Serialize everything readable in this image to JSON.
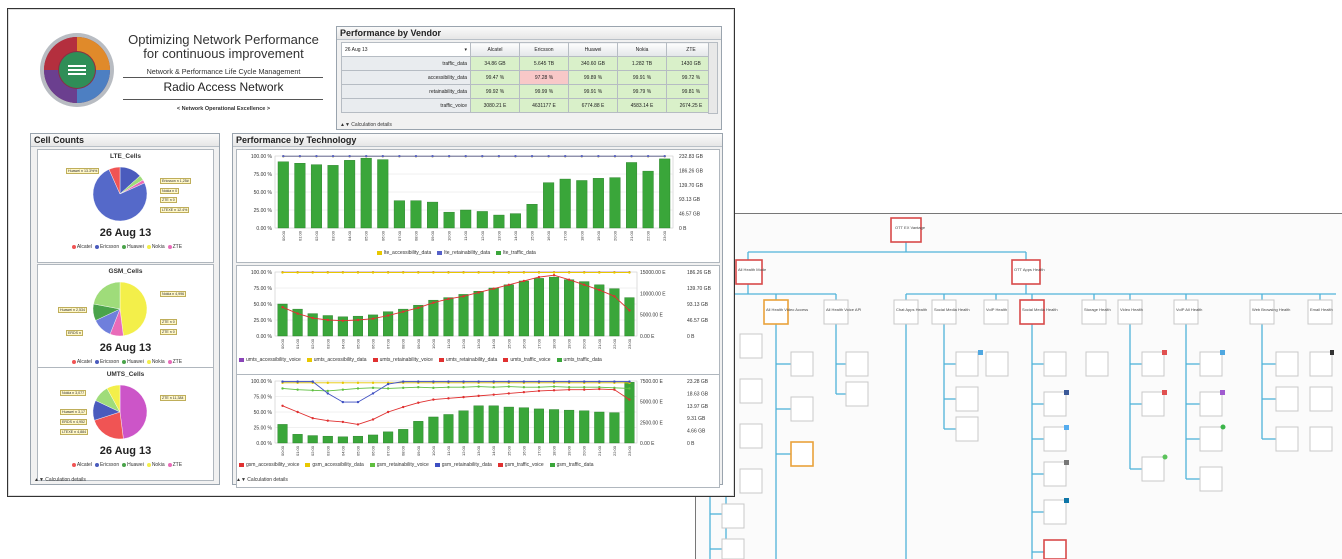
{
  "header": {
    "title_line1": "Optimizing Network Performance",
    "title_line2": "for continuous improvement",
    "subtitle": "Network & Performance Life Cycle Management",
    "subtitle2": "Radio Access Network",
    "tagline": "< Network Operational Excellence >"
  },
  "vendor_panel": {
    "title": "Performance by Vendor",
    "selected_date": "26 Aug 13",
    "columns": [
      "Alcatel",
      "Ericsson",
      "Huawei",
      "Nokia",
      "ZTE"
    ],
    "rows": [
      {
        "kpi": "traffic_data",
        "values": [
          "34.86 GB",
          "5.645 TB",
          "340.60 GB",
          "1.282 TB",
          "1430 GB"
        ]
      },
      {
        "kpi": "accessibility_data",
        "values": [
          "99.47 %",
          "97.28 %",
          "99.89 %",
          "99.91 %",
          "99.72 %"
        ]
      },
      {
        "kpi": "retainability_data",
        "values": [
          "99.92 %",
          "99.99 %",
          "99.91 %",
          "99.79 %",
          "99.81 %"
        ]
      },
      {
        "kpi": "traffic_voice",
        "values": [
          "3080.21 E",
          "4631177 E",
          "6774.88 E",
          "4583.14 E",
          "2674.25 E"
        ]
      }
    ],
    "footer": "Calculation details"
  },
  "cells_panel": {
    "title": "Cell Counts",
    "pies": [
      {
        "title": "LTE_Cells",
        "date": "26 Aug 13",
        "slices": [
          {
            "name": "Huawei",
            "value": 13.3,
            "color": "#4a5bbd"
          },
          {
            "name": "Nokia",
            "value": 3,
            "color": "#9fdc7a"
          },
          {
            "name": "ZTE",
            "value": 2,
            "color": "#e96bb9"
          },
          {
            "name": "Ericsson",
            "value": 75,
            "color": "#5569c9"
          },
          {
            "name": "Alcatel",
            "value": 6.7,
            "color": "#f05454"
          }
        ],
        "labels": [
          "Huawei n 13.3%%",
          "Ericsson n 1,25#",
          "Nokia n 0",
          "ZTE n 0",
          "LTEXE n 12.4%"
        ]
      },
      {
        "title": "GSM_Cells",
        "date": "26 Aug 13",
        "slices": [
          {
            "name": "Nokia",
            "value": 48,
            "color": "#f3ef4a"
          },
          {
            "name": "ZTE",
            "value": 8,
            "color": "#e96bb9"
          },
          {
            "name": "Huawei",
            "value": 12,
            "color": "#6f7fdc"
          },
          {
            "name": "Ericsson",
            "value": 10,
            "color": "#4aa34a"
          },
          {
            "name": "Alcatel",
            "value": 22,
            "color": "#9fdc7a"
          }
        ],
        "labels": [
          "Nokia n 4,996",
          "Huawei n 2,534",
          "ERDS n",
          "ZTE n 0",
          "ZTE n 0"
        ]
      },
      {
        "title": "UMTS_Cells",
        "date": "26 Aug 13",
        "slices": [
          {
            "name": "ZTE",
            "value": 48,
            "color": "#cc55c8"
          },
          {
            "name": "Alcatel",
            "value": 22,
            "color": "#f05454"
          },
          {
            "name": "Ericsson",
            "value": 12,
            "color": "#4a5bbd"
          },
          {
            "name": "Huawei",
            "value": 10,
            "color": "#9fdc7a"
          },
          {
            "name": "Nokia",
            "value": 8,
            "color": "#f3ef4a"
          }
        ],
        "labels": [
          "Nokia n 3,077",
          "ZTE n 11,384",
          "Huawei n 3,17",
          "ERDS n 4,952",
          "LTEXE n 4,884"
        ]
      }
    ],
    "legend": [
      {
        "name": "Alcatel",
        "color": "#f05454"
      },
      {
        "name": "Ericsson",
        "color": "#4a5bbd"
      },
      {
        "name": "Huawei",
        "color": "#4aa34a"
      },
      {
        "name": "Nokia",
        "color": "#f3ef4a"
      },
      {
        "name": "ZTE",
        "color": "#e96bb9"
      }
    ],
    "footer": "Calculation details"
  },
  "tech_panel": {
    "title": "Performance by Technology",
    "footer": "Calculation details",
    "charts": [
      {
        "key": "lte",
        "left_ticks": [
          "100.00 %",
          "75.00 %",
          "50.00 %",
          "25.00 %",
          "0.00 %"
        ],
        "right_ticks": [
          "232.83 GB",
          "186.26 GB",
          "139.70 GB",
          "93.13 GB",
          "46.57 GB",
          "0 B"
        ],
        "right2_ticks": [],
        "x": [
          "00:00",
          "01:00",
          "02:00",
          "03:00",
          "04:00",
          "05:00",
          "06:00",
          "07:00",
          "08:00",
          "09:00",
          "10:00",
          "11:00",
          "12:00",
          "13:00",
          "14:00",
          "15:00",
          "16:00",
          "17:00",
          "18:00",
          "19:00",
          "20:00",
          "21:00",
          "22:00",
          "23:00"
        ],
        "bars": [
          92,
          90,
          88,
          87,
          94,
          97,
          95,
          38,
          38,
          36,
          22,
          25,
          23,
          18,
          20,
          33,
          63,
          68,
          66,
          69,
          70,
          91,
          79,
          96
        ],
        "lines": [
          {
            "name": "lte_accessibility_data",
            "color": "#e8c800",
            "values": [
              99.5,
              99.5,
              99.5,
              99.5,
              99.5,
              99.5,
              99.5,
              99.5,
              99.5,
              99.5,
              99.5,
              99.5,
              99.5,
              99.5,
              99.5,
              99.5,
              99.5,
              99.5,
              99.5,
              99.5,
              99.5,
              99.5,
              99.5,
              99.5
            ]
          },
          {
            "name": "lte_retainability_data",
            "color": "#5560c8",
            "values": [
              99.8,
              99.8,
              99.8,
              99.8,
              99.8,
              99.8,
              99.8,
              99.8,
              99.8,
              99.8,
              99.8,
              99.8,
              99.8,
              99.8,
              99.8,
              99.8,
              99.8,
              99.8,
              99.8,
              99.8,
              99.8,
              99.8,
              99.8,
              99.8
            ]
          }
        ],
        "legend": [
          "lte_accessibility_data",
          "lte_retainability_data",
          "lte_traffic_data"
        ]
      },
      {
        "key": "umts",
        "left_ticks": [
          "100.00 %",
          "75.00 %",
          "50.00 %",
          "25.00 %",
          "0.00 %"
        ],
        "right_ticks": [
          "186.26 GB",
          "139.70 GB",
          "93.13 GB",
          "46.57 GB",
          "0 B"
        ],
        "right2_ticks": [
          "15000.00 E",
          "10000.00 E",
          "5000.00 E",
          "0.00 E"
        ],
        "x": [
          "00:00",
          "01:00",
          "02:00",
          "03:00",
          "04:00",
          "05:00",
          "06:00",
          "07:00",
          "08:00",
          "09:00",
          "10:00",
          "11:00",
          "12:00",
          "13:00",
          "14:00",
          "15:00",
          "16:00",
          "17:00",
          "18:00",
          "19:00",
          "20:00",
          "21:00",
          "22:00",
          "23:00"
        ],
        "bars": [
          50,
          42,
          35,
          32,
          30,
          31,
          33,
          38,
          42,
          48,
          56,
          60,
          65,
          70,
          75,
          80,
          86,
          90,
          92,
          88,
          85,
          80,
          74,
          60
        ],
        "lines": [
          {
            "name": "umts_accessibility_voice",
            "color": "#8a44b8",
            "values": [
              99.6,
              99.6,
              99.6,
              99.6,
              99.6,
              99.6,
              99.6,
              99.6,
              99.6,
              99.6,
              99.6,
              99.6,
              99.6,
              99.6,
              99.6,
              99.6,
              99.6,
              99.6,
              99.6,
              99.6,
              99.6,
              99.6,
              99.6,
              99.6
            ]
          },
          {
            "name": "umts_accessibility_data",
            "color": "#e8c800",
            "values": [
              99.2,
              99.2,
              99.2,
              99.2,
              99.2,
              99.2,
              99.2,
              99.2,
              99.2,
              99.2,
              99.2,
              99.2,
              99.2,
              99.2,
              99.2,
              99.2,
              99.2,
              99.2,
              99.2,
              99.2,
              99.2,
              99.2,
              99.2,
              99.2
            ]
          },
          {
            "name": "umts_traffic_voice",
            "color": "#e03030",
            "values": [
              45,
              35,
              28,
              25,
              24,
              25,
              27,
              32,
              38,
              44,
              52,
              58,
              62,
              68,
              74,
              80,
              86,
              92,
              95,
              88,
              80,
              72,
              62,
              40
            ]
          }
        ],
        "legend": [
          "umts_accessibility_voice",
          "umts_accessibility_data",
          "umts_retainability_voice",
          "umts_retainability_data",
          "umts_traffic_voice",
          "umts_traffic_data"
        ]
      },
      {
        "key": "gsm",
        "left_ticks": [
          "100.00 %",
          "75.00 %",
          "50.00 %",
          "25.00 %",
          "0.00 %"
        ],
        "right_ticks": [
          "23.28 GB",
          "18.63 GB",
          "13.97 GB",
          "9.31 GB",
          "4.66 GB",
          "0 B"
        ],
        "right2_ticks": [
          "7500.00 E",
          "5000.00 E",
          "2500.00 E",
          "0.00 E"
        ],
        "x": [
          "00:00",
          "01:00",
          "02:00",
          "03:00",
          "04:00",
          "05:00",
          "06:00",
          "07:00",
          "08:00",
          "09:00",
          "10:00",
          "11:00",
          "12:00",
          "13:00",
          "14:00",
          "15:00",
          "16:00",
          "17:00",
          "18:00",
          "19:00",
          "20:00",
          "21:00",
          "22:00",
          "23:00"
        ],
        "bars": [
          30,
          14,
          12,
          11,
          10,
          11,
          13,
          18,
          22,
          35,
          42,
          46,
          52,
          60,
          60,
          58,
          57,
          55,
          54,
          53,
          52,
          50,
          49,
          98
        ],
        "lines": [
          {
            "name": "gsm_accessibility_data",
            "color": "#e8c800",
            "values": [
              97,
              97,
              97,
              97,
              97,
              97,
              97,
              97,
              97,
              97,
              97,
              97,
              97,
              97,
              97,
              97,
              97,
              97,
              97,
              97,
              97,
              97,
              97,
              97
            ]
          },
          {
            "name": "gsm_retainability_voice",
            "color": "#5fbf3f",
            "values": [
              88,
              86,
              85,
              84,
              86,
              88,
              89,
              88,
              89,
              90,
              89,
              90,
              90,
              91,
              90,
              91,
              90,
              90,
              91,
              90,
              90,
              90,
              89,
              88
            ]
          },
          {
            "name": "gsm_retainability_data",
            "color": "#3e4fc2",
            "values": [
              99,
              99,
              99,
              80,
              66,
              66,
              80,
              95,
              99,
              99,
              99,
              99,
              99,
              99,
              99,
              99,
              99,
              99,
              99,
              99,
              99,
              99,
              99,
              99
            ]
          },
          {
            "name": "gsm_accessibility_voice",
            "color": "#e03030",
            "values": [
              60,
              50,
              40,
              36,
              34,
              30,
              38,
              50,
              58,
              65,
              70,
              72,
              74,
              76,
              78,
              80,
              82,
              84,
              85,
              86,
              86,
              87,
              86,
              70
            ]
          }
        ],
        "legend": [
          "gsm_accessibility_voice",
          "gsm_accessibility_data",
          "gsm_retainability_voice",
          "gsm_retainability_data",
          "gsm_traffic_voice",
          "gsm_traffic_data"
        ]
      }
    ]
  },
  "tree": {
    "root": "OTT EX Vantage",
    "level1": [
      "All Health Mode",
      "OTT Apps Health"
    ],
    "level2": [
      "All Health Video Access",
      "All Health Voice API",
      "Chat Apps Health",
      "Social Media Health",
      "VoIP Health",
      "Social Media Health",
      "Storage Health",
      "Video Health",
      "VoIP All Health",
      "Web Browsing Health",
      "Email Health"
    ]
  }
}
